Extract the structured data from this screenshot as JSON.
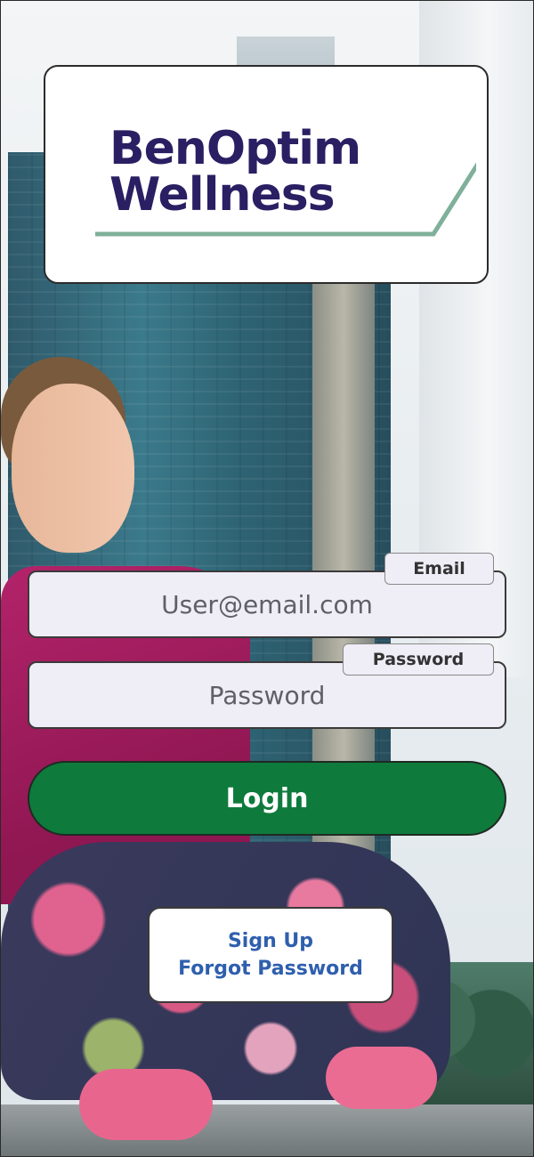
{
  "logo": {
    "line1": "BenOptim",
    "line2": "Wellness",
    "text_color": "#2a1f63",
    "accent_line_color": "#7fb09a"
  },
  "form": {
    "email": {
      "label": "Email",
      "placeholder": "User@email.com"
    },
    "password": {
      "label": "Password",
      "placeholder": "Password"
    },
    "login_label": "Login",
    "login_color": "#0e7a3c"
  },
  "links": {
    "sign_up": "Sign Up",
    "forgot_password": "Forgot Password",
    "color": "#2f5fae"
  },
  "background": {
    "icon": "yoga-city-photo"
  }
}
